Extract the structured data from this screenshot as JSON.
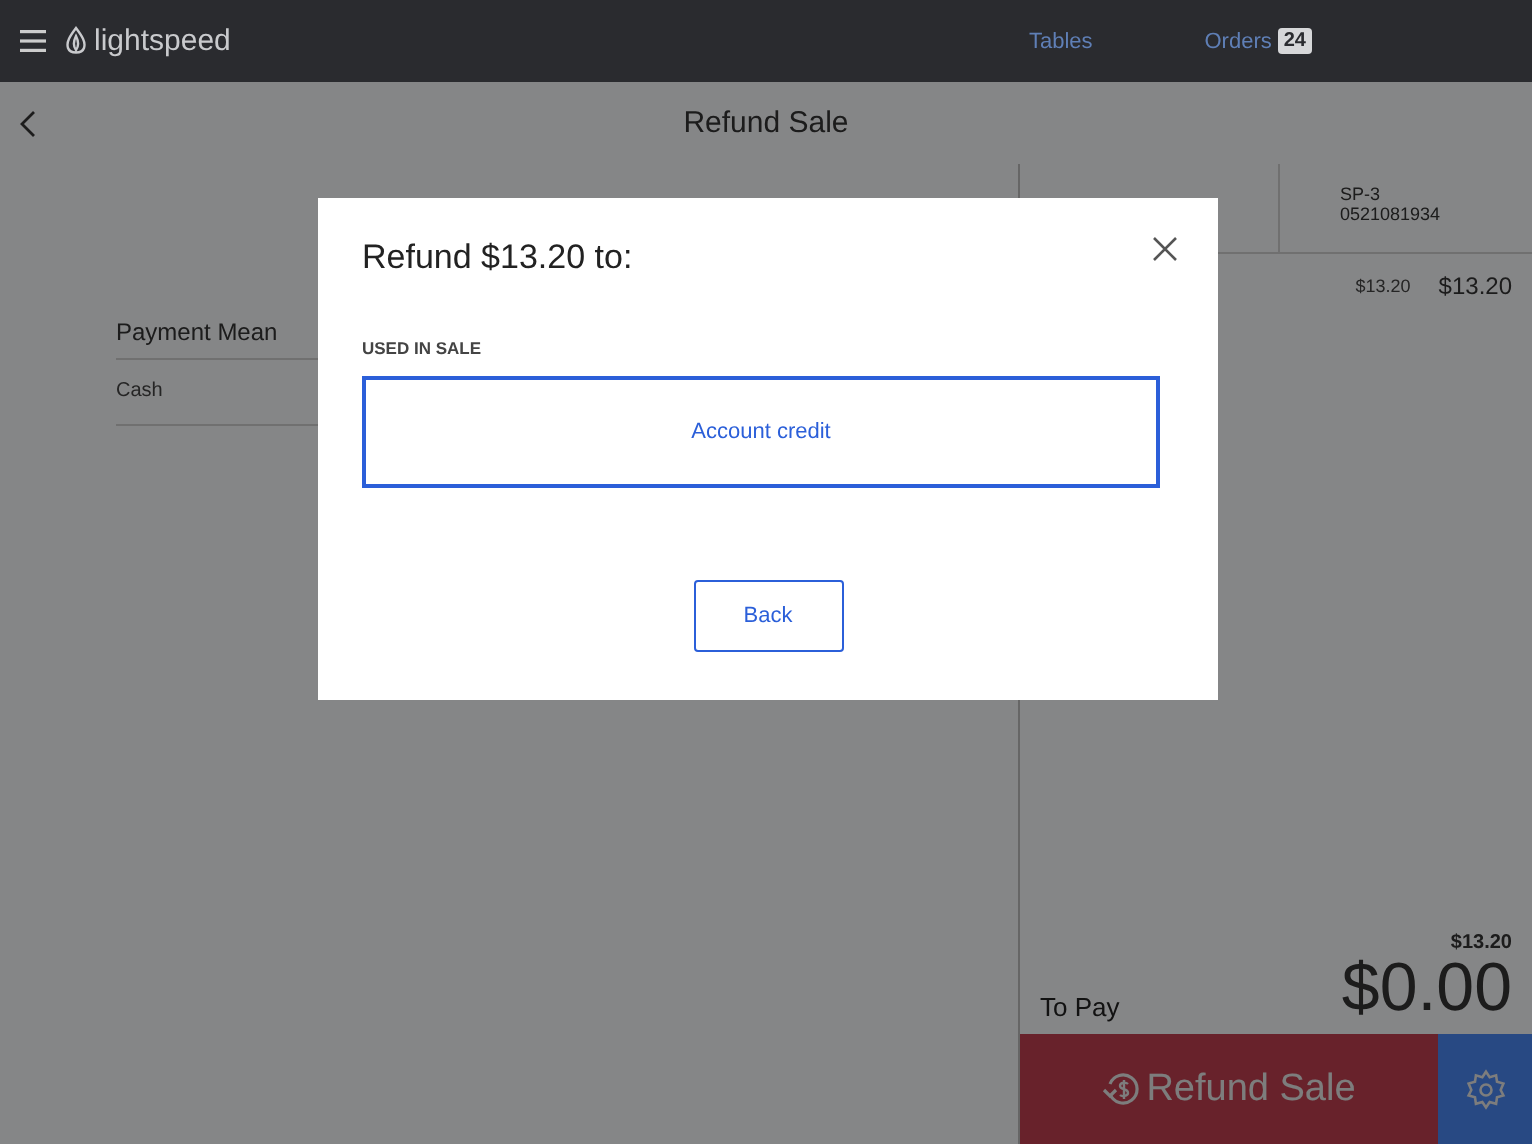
{
  "top_bar": {
    "brand": "lightspeed",
    "nav": [
      {
        "label": "Tables"
      },
      {
        "label": "Orders",
        "badge": "24"
      }
    ]
  },
  "page": {
    "title": "Refund Sale"
  },
  "payments": {
    "header": "Payment Mean",
    "rows": [
      "Cash"
    ]
  },
  "sale_panel": {
    "reference": "SP-3",
    "code": "0521081934",
    "items": [
      {
        "price": "$13.20",
        "total": "$13.20"
      }
    ],
    "subtotal": "$13.20",
    "to_pay_label": "To Pay",
    "to_pay": "$0.00",
    "refund_button": "Refund Sale"
  },
  "dialog": {
    "title": "Refund $13.20 to:",
    "section": "USED IN SALE",
    "options": [
      {
        "label": "Account credit",
        "selected": true
      }
    ],
    "back_button": "Back"
  }
}
